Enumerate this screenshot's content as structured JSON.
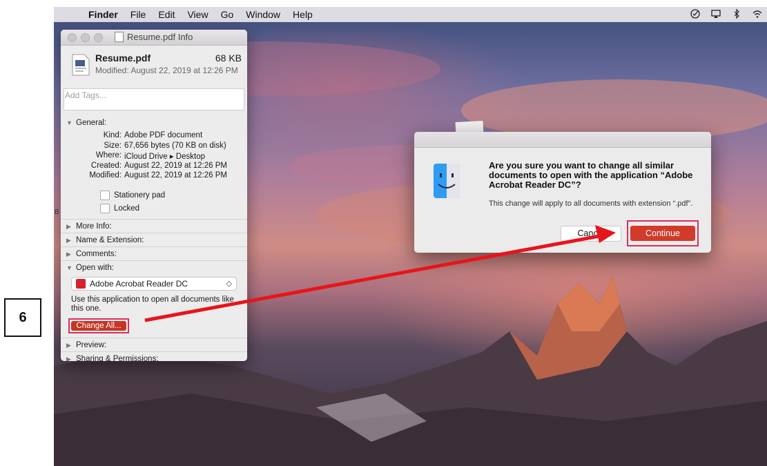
{
  "menubar": {
    "items": [
      "Finder",
      "File",
      "Edit",
      "View",
      "Go",
      "Window",
      "Help"
    ]
  },
  "info_window": {
    "title": "Resume.pdf Info",
    "file_name": "Resume.pdf",
    "file_size": "68 KB",
    "modified_line": "Modified: August 22, 2019 at 12:26 PM",
    "tags_placeholder": "Add Tags...",
    "sections": {
      "general": "General:",
      "more_info": "More Info:",
      "name_ext": "Name & Extension:",
      "comments": "Comments:",
      "open_with": "Open with:",
      "preview": "Preview:",
      "sharing": "Sharing & Permissions:"
    },
    "general_rows": [
      {
        "k": "Kind:",
        "v": "Adobe PDF document"
      },
      {
        "k": "Size:",
        "v": "67,656 bytes (70 KB on disk)"
      },
      {
        "k": "Where:",
        "v": "iCloud Drive ▸ Desktop"
      },
      {
        "k": "Created:",
        "v": "August 22, 2019 at 12:26 PM"
      },
      {
        "k": "Modified:",
        "v": "August 22, 2019 at 12:26 PM"
      }
    ],
    "stationery_label": "Stationery pad",
    "locked_label": "Locked",
    "open_with_app": "Adobe Acrobat Reader DC",
    "use_text": "Use this application to open all documents like this one.",
    "change_all_label": "Change All..."
  },
  "dialog": {
    "question": "Are you sure you want to change all similar documents to open with the application “Adobe Acrobat Reader DC”?",
    "message": "This change will apply to all documents with extension “.pdf”.",
    "cancel_label": "Cancel",
    "continue_label": "Continue"
  },
  "annotation": {
    "step_number": "6",
    "edge_letter": "B"
  },
  "colors": {
    "highlight": "#d92f5e",
    "arrow": "#e8141b",
    "button_red": "#d23a2a"
  }
}
